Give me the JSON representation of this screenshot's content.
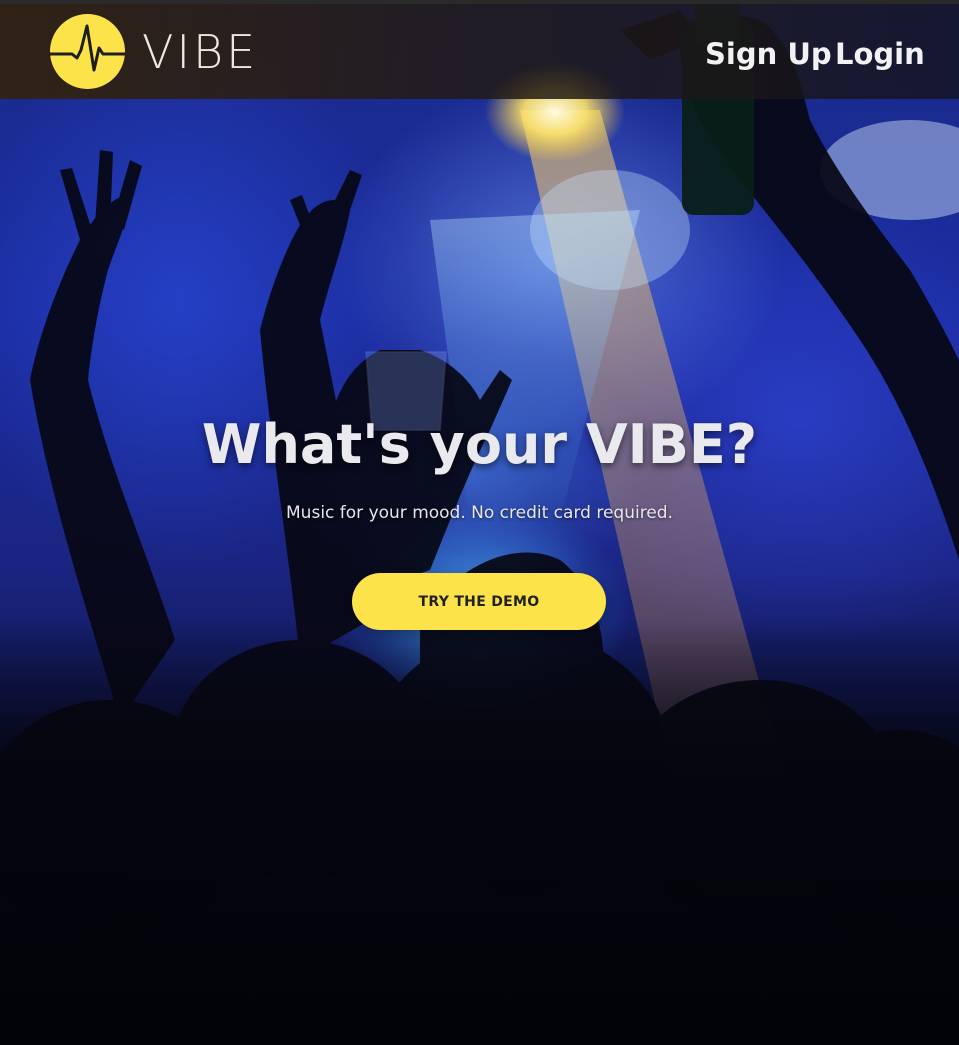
{
  "header": {
    "logo_text": "VIBE",
    "nav": {
      "signup_label": "Sign Up",
      "login_label": "Login"
    }
  },
  "hero": {
    "title": "What's your VIBE?",
    "subtitle": "Music for your mood. No credit card required.",
    "cta_label": "TRY THE DEMO"
  },
  "icons": {
    "logo": "pulse-wave-icon"
  },
  "colors": {
    "accent": "#fde34a",
    "header_bg": "#2a1e10",
    "text_light": "#ece8df"
  }
}
